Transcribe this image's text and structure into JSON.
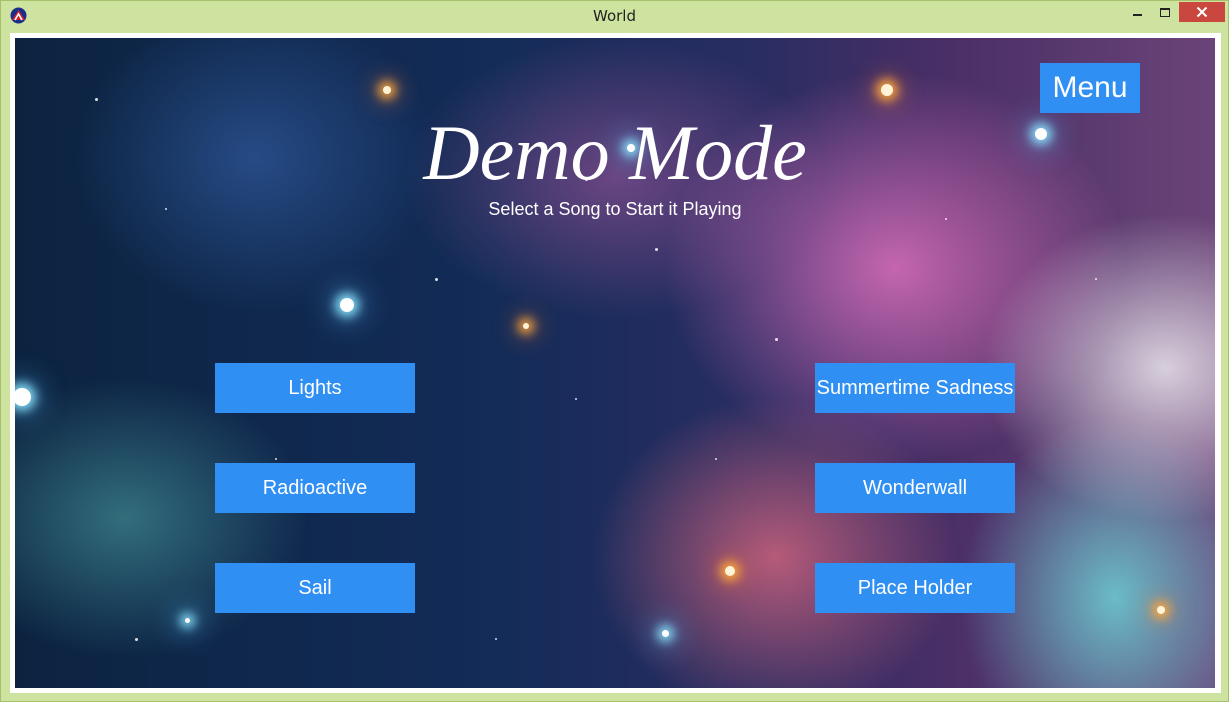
{
  "window": {
    "title": "World",
    "colors": {
      "frame": "#cfe3a0",
      "close_button": "#c9473f"
    }
  },
  "screen": {
    "heading": "Demo Mode",
    "subheading": "Select a Song to Start it Playing",
    "menu_label": "Menu",
    "button_color": "#2f8ff3",
    "songs": {
      "left": [
        "Lights",
        "Radioactive",
        "Sail"
      ],
      "right": [
        "Summertime Sadness",
        "Wonderwall",
        "Place Holder"
      ]
    }
  },
  "icons": [
    "app-icon",
    "minimize-icon",
    "maximize-icon",
    "close-icon"
  ]
}
